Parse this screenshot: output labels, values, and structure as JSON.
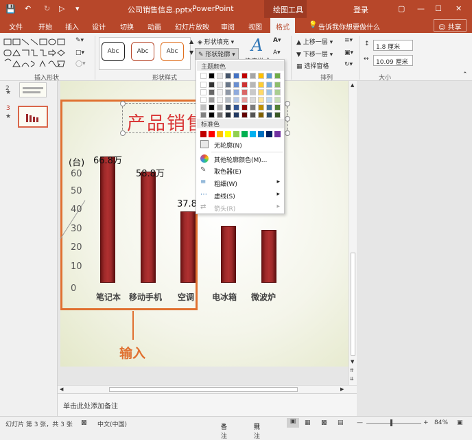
{
  "titlebar": {
    "filename": "公司销售信息.pptx",
    "separator": " - ",
    "app": "PowerPoint",
    "context_tab": "绘图工具",
    "login": "登录"
  },
  "tabs": [
    "文件",
    "开始",
    "插入",
    "设计",
    "切换",
    "动画",
    "幻灯片放映",
    "审阅",
    "视图",
    "格式"
  ],
  "active_tab": "格式",
  "tell_me": "告诉我你想要做什么",
  "share": "共享",
  "ribbon": {
    "group_insert_shapes": "插入形状",
    "group_shape_styles": "形状样式",
    "group_arrange": "排列",
    "group_size": "大小",
    "style_samples": [
      "Abc",
      "Abc",
      "Abc"
    ],
    "shape_fill": "形状填充",
    "shape_outline": "形状轮廓",
    "quick_styles": "快速样式",
    "bring_forward": "上移一层",
    "send_backward": "下移一层",
    "selection_pane": "选择窗格",
    "height": "1.8 厘米",
    "width": "10.09 厘米"
  },
  "outline_menu": {
    "theme_colors_header": "主题颜色",
    "standard_colors_header": "标准色",
    "no_outline": "无轮廓(N)",
    "more_colors": "其他轮廓颜色(M)...",
    "eyedropper": "取色器(E)",
    "weight": "粗细(W)",
    "dashes": "虚线(S)",
    "arrows": "箭头(R)",
    "theme_top_row": [
      "#ffffff",
      "#000000",
      "#e7e6e6",
      "#44546a",
      "#4472c4",
      "#c00000",
      "#a5a5a5",
      "#ffc000",
      "#5b9bd5",
      "#70ad47"
    ],
    "standard_colors": [
      "#c00000",
      "#ff0000",
      "#ffc000",
      "#ffff00",
      "#92d050",
      "#00b050",
      "#00b0f0",
      "#0070c0",
      "#002060",
      "#7030a0"
    ]
  },
  "slides": {
    "slide2_num": "2",
    "slide3_num": "3"
  },
  "chart_data": {
    "type": "bar",
    "title": "产品销售",
    "unit_label": "(台)",
    "categories": [
      "笔记本",
      "移动手机",
      "空调",
      "电冰箱",
      "微波炉"
    ],
    "values": [
      66.8,
      58.8,
      37.8,
      30,
      28
    ],
    "value_labels": [
      "66.8万",
      "58.8万",
      "37.8",
      null,
      null
    ],
    "y_ticks": [
      "0",
      "10",
      "20",
      "30",
      "40",
      "50",
      "60"
    ],
    "ylim": [
      0,
      70
    ]
  },
  "annotation": {
    "callout": "输入"
  },
  "notes_placeholder": "单击此处添加备注",
  "status": {
    "slide_info": "幻灯片 第 3 张，共 3 张",
    "language": "中文(中国)",
    "notes": "备注",
    "comments": "批注",
    "zoom": "84%"
  }
}
